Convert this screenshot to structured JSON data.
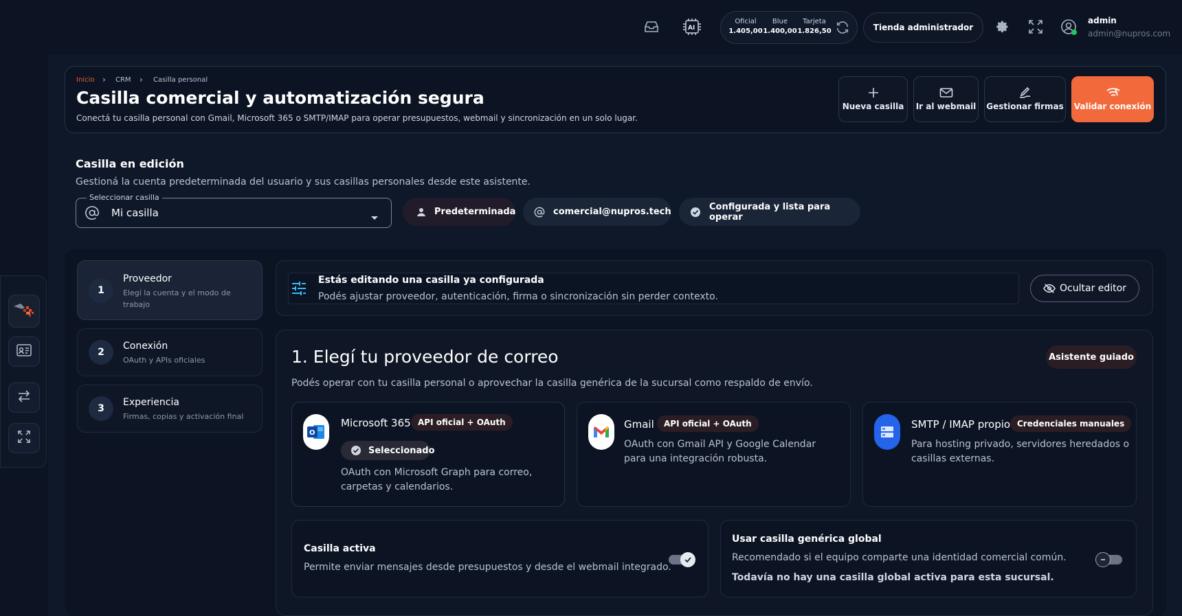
{
  "topbar": {
    "rates": [
      {
        "label": "Oficial",
        "value": "1.405,00"
      },
      {
        "label": "Blue",
        "value": "1.400,00"
      },
      {
        "label": "Tarjeta",
        "value": "1.826,50"
      }
    ],
    "store_button": "Tienda administrador",
    "user": {
      "name": "admin",
      "email": "admin@nupros.com"
    },
    "status_color": "#22c55e"
  },
  "breadcrumb": [
    "Inicio",
    "CRM",
    "Casilla personal"
  ],
  "header": {
    "title": "Casilla comercial y automatización segura",
    "subtitle": "Conectá tu casilla personal con Gmail, Microsoft 365 o SMTP/IMAP para operar presupuestos, webmail y sincronización en un solo lugar.",
    "actions": {
      "new_mailbox": "Nueva casilla",
      "webmail": "Ir al webmail",
      "signatures": "Gestionar firmas",
      "validate": "Validar conexión"
    },
    "accent": "#f26a3b"
  },
  "editing": {
    "title": "Casilla en edición",
    "subtitle": "Gestioná la cuenta predeterminada del usuario y sus casillas personales desde este asistente.",
    "select_label": "Seleccionar casilla",
    "select_value": "Mi casilla",
    "pill_default": "Predeterminada",
    "pill_email": "comercial@nupros.tech",
    "pill_status": "Configurada y lista para operar"
  },
  "steps": [
    {
      "number": "1",
      "title": "Proveedor",
      "subtitle": "Elegí la cuenta y el modo de trabajo"
    },
    {
      "number": "2",
      "title": "Conexión",
      "subtitle": "OAuth y APIs oficiales"
    },
    {
      "number": "3",
      "title": "Experiencia",
      "subtitle": "Firmas, copias y activación final"
    }
  ],
  "info": {
    "title": "Estás editando una casilla ya configurada",
    "subtitle": "Podés ajustar proveedor, autenticación, firma o sincronización sin perder contexto.",
    "hide_button": "Ocultar editor"
  },
  "provider": {
    "title": "1. Elegí tu proveedor de correo",
    "guided": "Asistente guiado",
    "subtitle": "Podés operar con tu casilla personal o aprovechar la casilla genérica de la sucursal como respaldo de envío.",
    "options": [
      {
        "name": "Microsoft 365",
        "badge": "API oficial + OAuth",
        "selected": "Seleccionado",
        "desc": "OAuth con Microsoft Graph para correo, carpetas y calendarios."
      },
      {
        "name": "Gmail",
        "badge": "API oficial + OAuth",
        "desc": "OAuth con Gmail API y Google Calendar para una integración robusta."
      },
      {
        "name": "SMTP / IMAP propio",
        "badge": "Credenciales manuales",
        "desc": "Para hosting privado, servidores heredados o casillas externas."
      }
    ]
  },
  "toggles": {
    "active": {
      "title": "Casilla activa",
      "desc": "Permite enviar mensajes desde presupuestos y desde el webmail integrado."
    },
    "global": {
      "title": "Usar casilla genérica global",
      "desc": "Recomendado si el equipo comparte una identidad comercial común.",
      "note": "Todavía no hay una casilla global activa para esta sucursal."
    }
  }
}
